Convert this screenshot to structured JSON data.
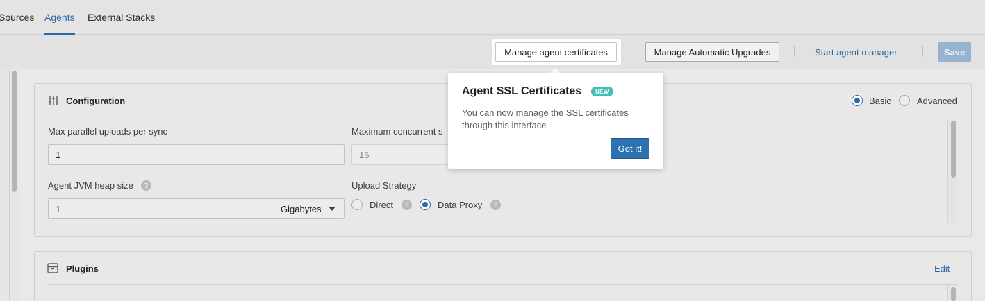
{
  "tabs": [
    {
      "label": "Sources",
      "active": false
    },
    {
      "label": "Agents",
      "active": true
    },
    {
      "label": "External Stacks",
      "active": false
    }
  ],
  "toolbar": {
    "manage_certs": "Manage agent certificates",
    "manage_upgrades": "Manage Automatic Upgrades",
    "start_manager": "Start agent manager",
    "save": "Save"
  },
  "configuration": {
    "title": "Configuration",
    "mode_basic": "Basic",
    "mode_advanced": "Advanced",
    "selected_mode": "Basic",
    "max_uploads_label": "Max parallel uploads per sync",
    "max_uploads_value": "1",
    "max_concurrent_label": "Maximum concurrent s",
    "max_concurrent_value": "16",
    "heap_label": "Agent JVM heap size",
    "heap_value": "1",
    "heap_unit": "Gigabytes",
    "upload_strategy_label": "Upload Strategy",
    "strategy_direct": "Direct",
    "strategy_proxy": "Data Proxy",
    "selected_strategy": "Data Proxy"
  },
  "plugins": {
    "title": "Plugins",
    "edit": "Edit"
  },
  "popover": {
    "title": "Agent SSL Certificates",
    "badge": "NEW",
    "body": "You can now manage the SSL certificates through this interface",
    "button": "Got it!"
  },
  "colors": {
    "accent": "#2b6aa6",
    "badge": "#3fbfb3",
    "primary_button": "#2d72b0"
  }
}
